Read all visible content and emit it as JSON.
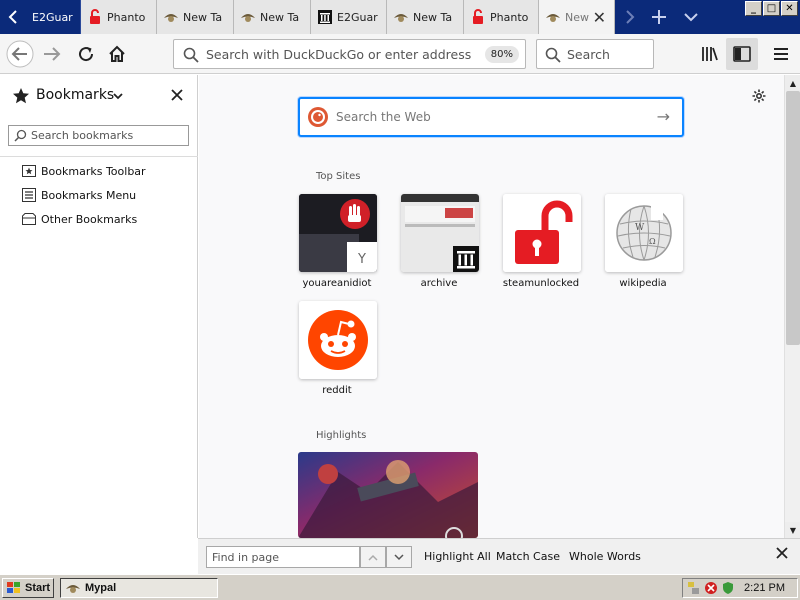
{
  "tabs": [
    {
      "label": "E2Guar",
      "style": "dark"
    },
    {
      "label": "Phanto",
      "style": "dark"
    },
    {
      "label": "New Ta",
      "style": "light"
    },
    {
      "label": "New Ta",
      "style": "light"
    },
    {
      "label": "E2Guar",
      "style": "light"
    },
    {
      "label": "New Ta",
      "style": "light"
    },
    {
      "label": "Phanto",
      "style": "light"
    },
    {
      "label": "New",
      "style": "active"
    }
  ],
  "window_controls": {
    "minimize": "_",
    "maximize": "□",
    "close": "✕"
  },
  "navbar": {
    "url_placeholder": "Search with DuckDuckGo or enter address",
    "zoom": "80%",
    "search_placeholder": "Search"
  },
  "sidebar": {
    "title": "Bookmarks",
    "search_placeholder": "Search bookmarks",
    "items": [
      {
        "label": "Bookmarks Toolbar",
        "icon": "bookmarks-toolbar-icon"
      },
      {
        "label": "Bookmarks Menu",
        "icon": "bookmarks-menu-icon"
      },
      {
        "label": "Other Bookmarks",
        "icon": "folder-icon"
      }
    ]
  },
  "newtab": {
    "search_placeholder": "Search the Web",
    "top_sites_title": "Top Sites",
    "top_sites": [
      {
        "label": "youareanidiot"
      },
      {
        "label": "archive"
      },
      {
        "label": "steamunlocked"
      },
      {
        "label": "wikipedia"
      },
      {
        "label": "reddit"
      }
    ],
    "highlights_title": "Highlights"
  },
  "findbar": {
    "placeholder": "Find in page",
    "highlight_all": "Highlight All",
    "match_case": "Match Case",
    "whole_words": "Whole Words"
  },
  "taskbar": {
    "start_label": "Start",
    "task_label": "Mypal",
    "clock": "2:21 PM"
  },
  "colors": {
    "tabbar_bg": "#0b2a7a",
    "focus_blue": "#0a84ff",
    "reddit_orange": "#ff4500",
    "steam_red": "#e51c23"
  }
}
